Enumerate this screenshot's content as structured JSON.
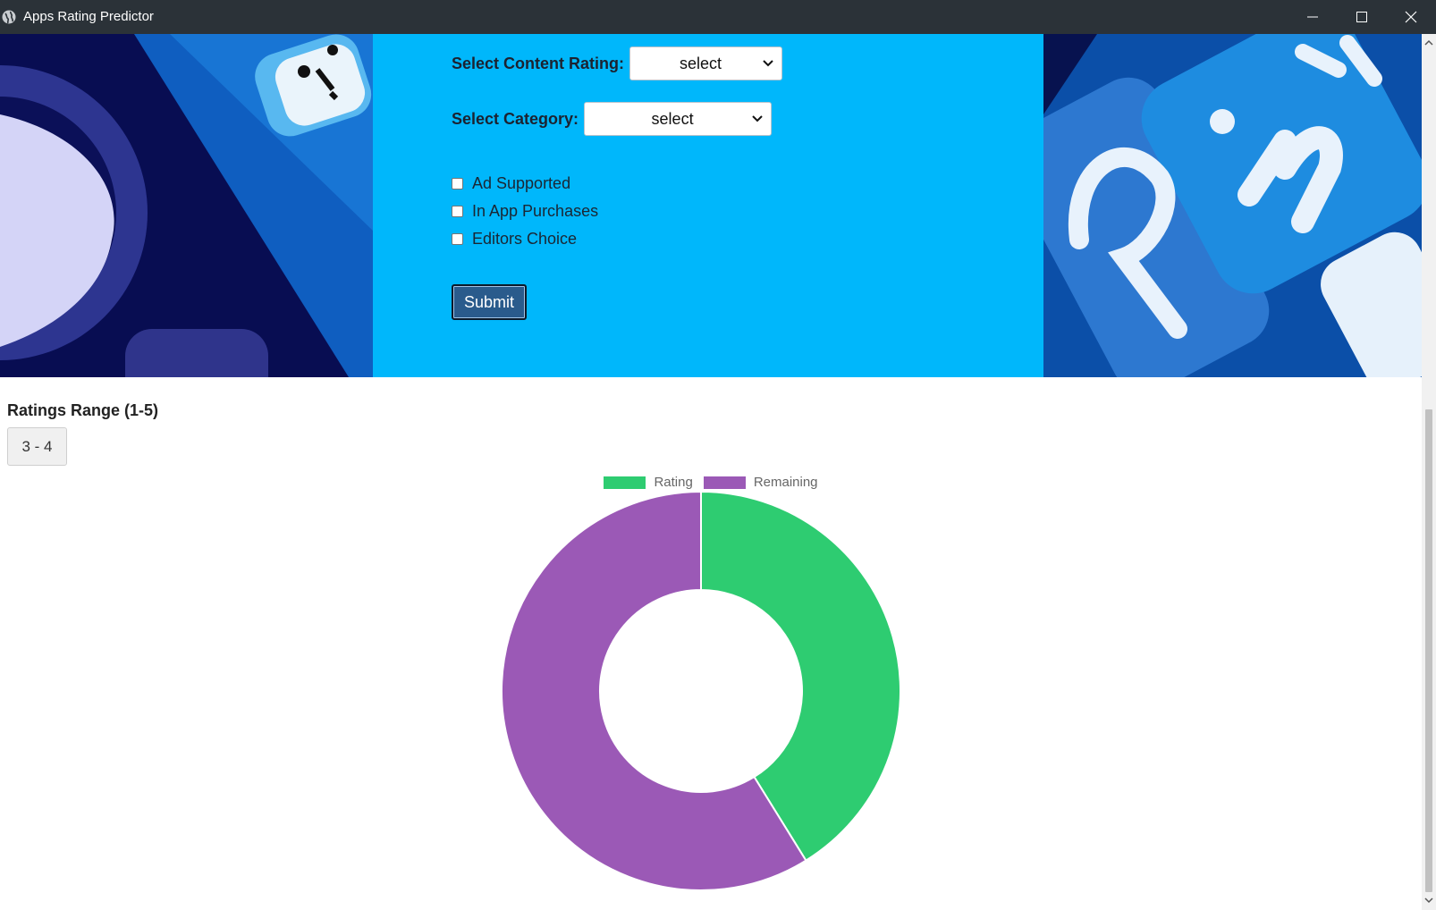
{
  "window": {
    "title": "Apps Rating Predictor",
    "icons": [
      "app-globe-icon",
      "minimize-icon",
      "maximize-icon",
      "close-icon"
    ]
  },
  "form": {
    "content_rating_label": "Select Content Rating:",
    "content_rating_value": "select",
    "category_label": "Select Category:",
    "category_value": "select",
    "checkboxes": [
      {
        "label": "Ad Supported",
        "checked": false
      },
      {
        "label": "In App Purchases",
        "checked": false
      },
      {
        "label": "Editors Choice",
        "checked": false
      }
    ],
    "submit_label": "Submit"
  },
  "result": {
    "range_title": "Ratings Range (1-5)",
    "range_value": "3 - 4"
  },
  "colors": {
    "panel": "#00b7fb",
    "rating": "#2ecc71",
    "remaining": "#9b59b6",
    "submit": "#2a5b8c"
  },
  "chart_data": {
    "type": "doughnut",
    "labels": [
      "Rating",
      "Remaining"
    ],
    "values": [
      3.5,
      5
    ],
    "legend": "top"
  }
}
